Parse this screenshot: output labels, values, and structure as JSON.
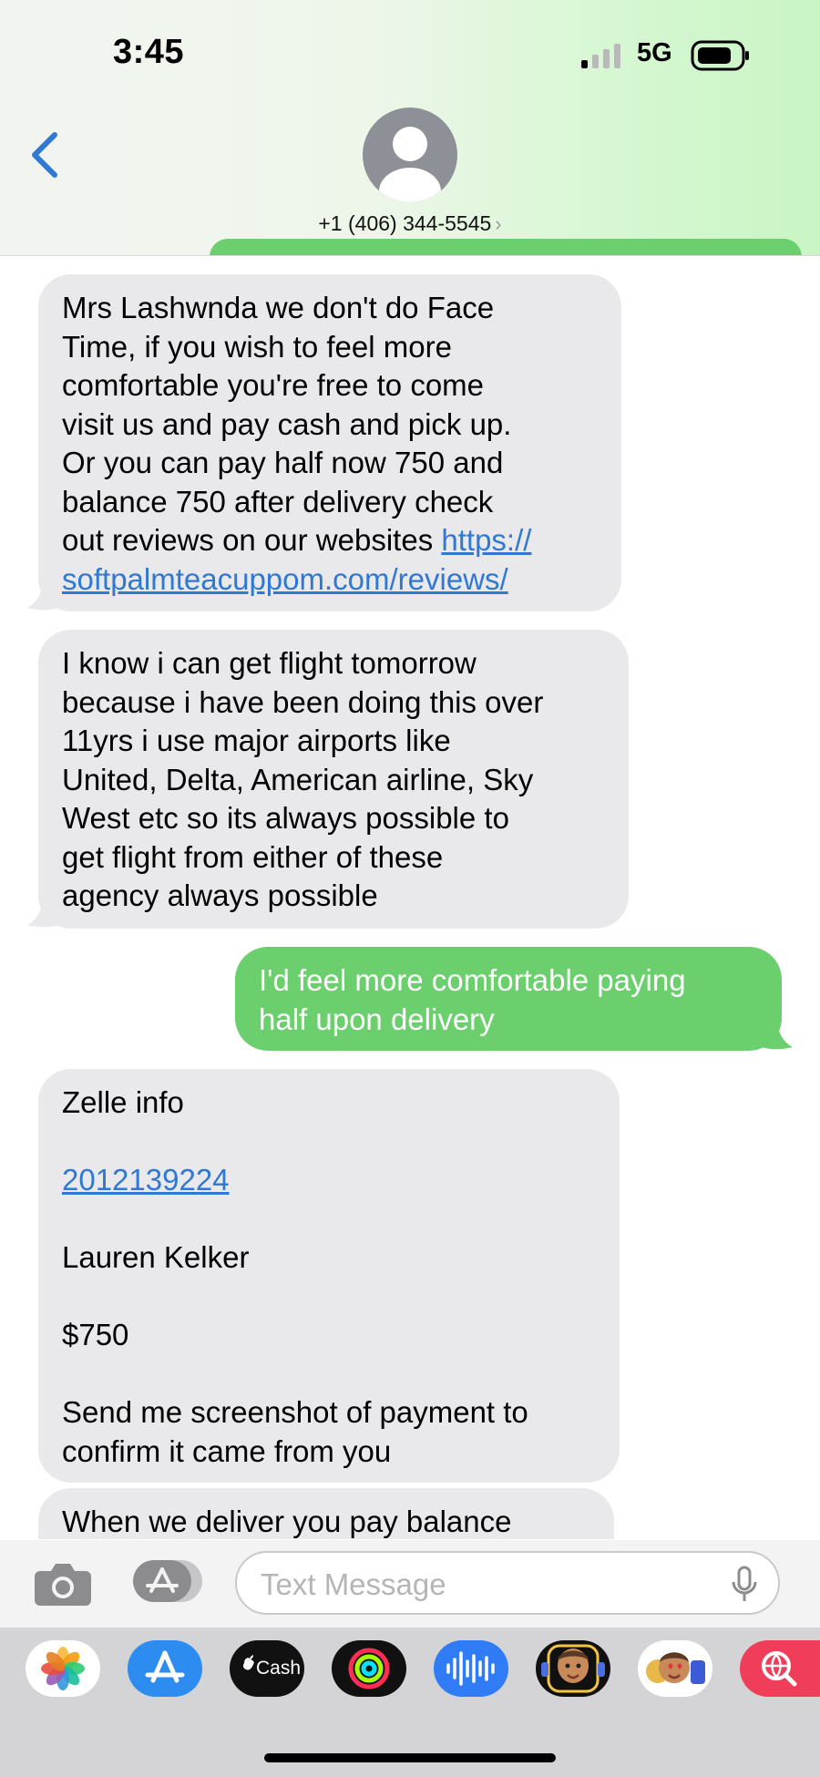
{
  "status_bar": {
    "time": "3:45",
    "network": "5G"
  },
  "header": {
    "contact": "+1 (406) 344-5545",
    "chevron": "›"
  },
  "messages": [
    {
      "direction": "incoming",
      "lines": [
        "Mrs Lashwnda we don't do Face",
        "Time, if you wish to feel more",
        "comfortable you're free to come",
        "visit us and pay cash and pick up.",
        "Or you can pay half now 750 and",
        "balance 750 after delivery check"
      ],
      "line7_text": "out reviews on our websites ",
      "link_part1": "https://",
      "link_part2": "softpalmteacuppom.com/reviews/"
    },
    {
      "direction": "incoming",
      "lines": [
        "I know i can get flight tomorrow",
        "because i have been doing this over",
        "11yrs i use major airports like",
        "United, Delta, American airline, Sky",
        "West etc so its always possible to",
        "get flight from either of these",
        "agency always possible"
      ]
    },
    {
      "direction": "outgoing",
      "lines": [
        "I'd feel more comfortable paying",
        "half upon delivery"
      ]
    },
    {
      "direction": "incoming",
      "title": "Zelle info",
      "phone": "2012139224",
      "name": "Lauren Kelker",
      "amount": "$750",
      "lines": [
        "Send me screenshot of payment to",
        "confirm it came from you"
      ]
    },
    {
      "direction": "incoming",
      "lines": [
        "When we deliver you pay balance"
      ]
    }
  ],
  "compose": {
    "placeholder": "Text Message"
  },
  "app_drawer": {
    "apps": [
      {
        "icon": "photos-icon"
      },
      {
        "icon": "app-store-icon"
      },
      {
        "icon": "apple-cash-icon",
        "label": "Cash"
      },
      {
        "icon": "fitness-icon"
      },
      {
        "icon": "audio-message-icon"
      },
      {
        "icon": "memoji-icon"
      },
      {
        "icon": "animoji-icon"
      },
      {
        "icon": "image-search-icon"
      }
    ]
  },
  "colors": {
    "incoming_bubble": "#e9e9eb",
    "outgoing_bubble": "#6ccf6e",
    "link": "#2f78d4",
    "accent": "#2f78d4"
  }
}
